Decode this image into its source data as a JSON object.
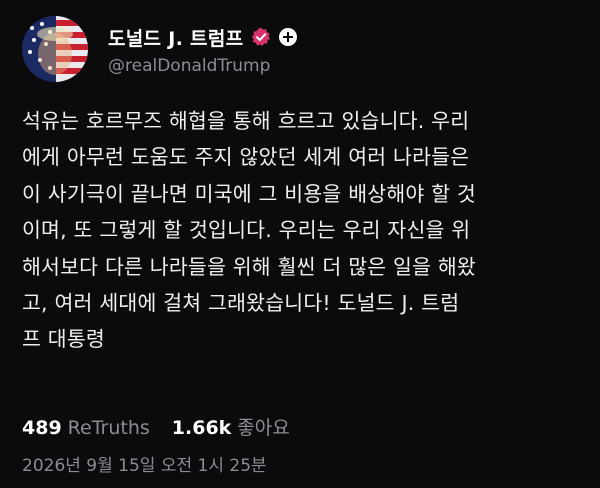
{
  "author": {
    "display_name": "도널드 J. 트럼프",
    "handle": "@realDonaldTrump",
    "verified_icon": "verified-badge-icon",
    "add_icon": "plus-icon",
    "colors": {
      "verified": "#d6336c",
      "name": "#ffffff",
      "handle": "#8c8c94"
    }
  },
  "post": {
    "text": "석유는 호르무즈 해협을 통해 흐르고 있습니다. 우리\n에게 아무런 도움도 주지 않았던 세계 여러 나라들은\n이 사기극이 끝나면 미국에 그 비용을 배상해야 할 것\n이며, 또 그렇게 할 것입니다. 우리는 우리 자신을 위\n해서보다 다른 나라들을 위해 훨씬 더 많은 일을 해왔\n고, 여러 세대에 걸쳐 그래왔습니다! 도널드 J. 트럼\n프 대통령"
  },
  "stats": {
    "retruths_count": "489",
    "retruths_label": "ReTruths",
    "likes_count": "1.66k",
    "likes_label": "좋아요"
  },
  "timestamp": "2026년 9월 15일 오전 1시 25분"
}
